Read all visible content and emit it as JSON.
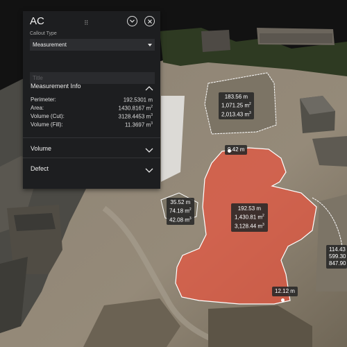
{
  "panel": {
    "title": "AC",
    "callout_type_label": "Callout Type",
    "callout_type_value": "Measurement",
    "title_placeholder": "Title",
    "measurement_info_label": "Measurement Info",
    "rows": [
      {
        "label": "Perimeter:",
        "value": "192.5301 m",
        "unit": ""
      },
      {
        "label": "Area:",
        "value": "1430.8167 m",
        "unit": "2"
      },
      {
        "label": "Volume (Cut):",
        "value": "3128.4453 m",
        "unit": "3"
      },
      {
        "label": "Volume (Fill):",
        "value": "11.3697 m",
        "unit": "3"
      }
    ],
    "volume_label": "Volume",
    "defect_label": "Defect"
  },
  "map_labels": {
    "top_area": {
      "l1": "183.56 m",
      "l2": "1,071.25 m",
      "l2sup": "2",
      "l3": "2,013.43 m",
      "l3sup": "3"
    },
    "edge_top": "9.42 m",
    "left_small": {
      "l1": "35.52 m",
      "l2": "74.18 m",
      "l2sup": "2",
      "l3": "42.08 m",
      "l3sup": "3"
    },
    "main_area": {
      "l1": "192.53 m",
      "l2": "1,430.81 m",
      "l2sup": "2",
      "l3": "3,128.44 m",
      "l3sup": "3"
    },
    "edge_bottom": "12.12 m",
    "right_partial": {
      "l1": "114.43",
      "l2": "599.30",
      "l3": "847.90"
    }
  },
  "colors": {
    "polygon_fill": "#e8553f",
    "panel_bg": "#1d1e20"
  }
}
